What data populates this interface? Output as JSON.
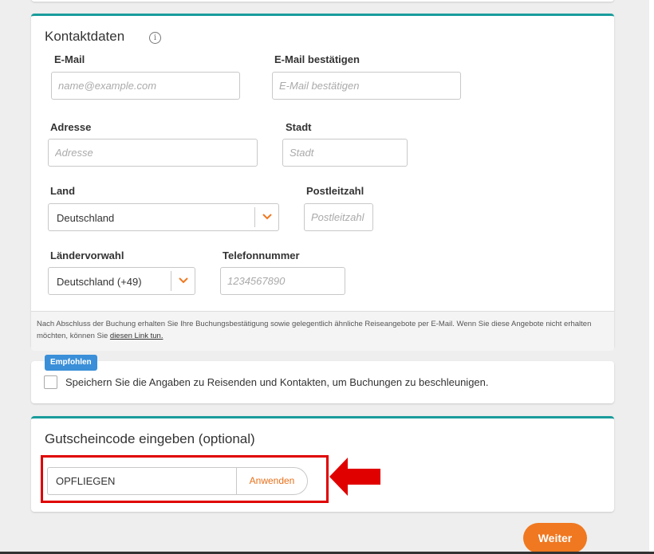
{
  "contact": {
    "title": "Kontaktdaten",
    "info_glyph": "i",
    "email_label": "E-Mail",
    "email_placeholder": "name@example.com",
    "email_confirm_label": "E-Mail bestätigen",
    "email_confirm_placeholder": "E-Mail bestätigen",
    "address_label": "Adresse",
    "address_placeholder": "Adresse",
    "city_label": "Stadt",
    "city_placeholder": "Stadt",
    "country_label": "Land",
    "country_value": "Deutschland",
    "zip_label": "Postleitzahl",
    "zip_placeholder": "Postleitzahl",
    "dial_label": "Ländervorwahl",
    "dial_value": "Deutschland (+49)",
    "phone_label": "Telefonnummer",
    "phone_placeholder": "1234567890",
    "notice_text": "Nach Abschluss der Buchung erhalten Sie Ihre Buchungsbestätigung sowie gelegentlich ähnliche Reiseangebote per E-Mail. Wenn Sie diese Angebote nicht erhalten möchten, können Sie ",
    "notice_link": "diesen Link tun."
  },
  "save": {
    "badge": "Empfohlen",
    "text": "Speichern Sie die Angaben zu Reisenden und Kontakten, um Buchungen zu beschleunigen.",
    "checked": false
  },
  "voucher": {
    "title": "Gutscheincode eingeben (optional)",
    "code_value": "OPFLIEGEN",
    "apply_label": "Anwenden"
  },
  "footer": {
    "next_label": "Weiter"
  },
  "colors": {
    "accent": "#f07820",
    "teal": "#1a9c9c",
    "badge": "#3a8fd8",
    "annotation": "#e00000"
  },
  "icons": {
    "info": "info-icon",
    "chevron": "chevron-down-icon",
    "annotation_arrow": "arrow-left-icon"
  }
}
